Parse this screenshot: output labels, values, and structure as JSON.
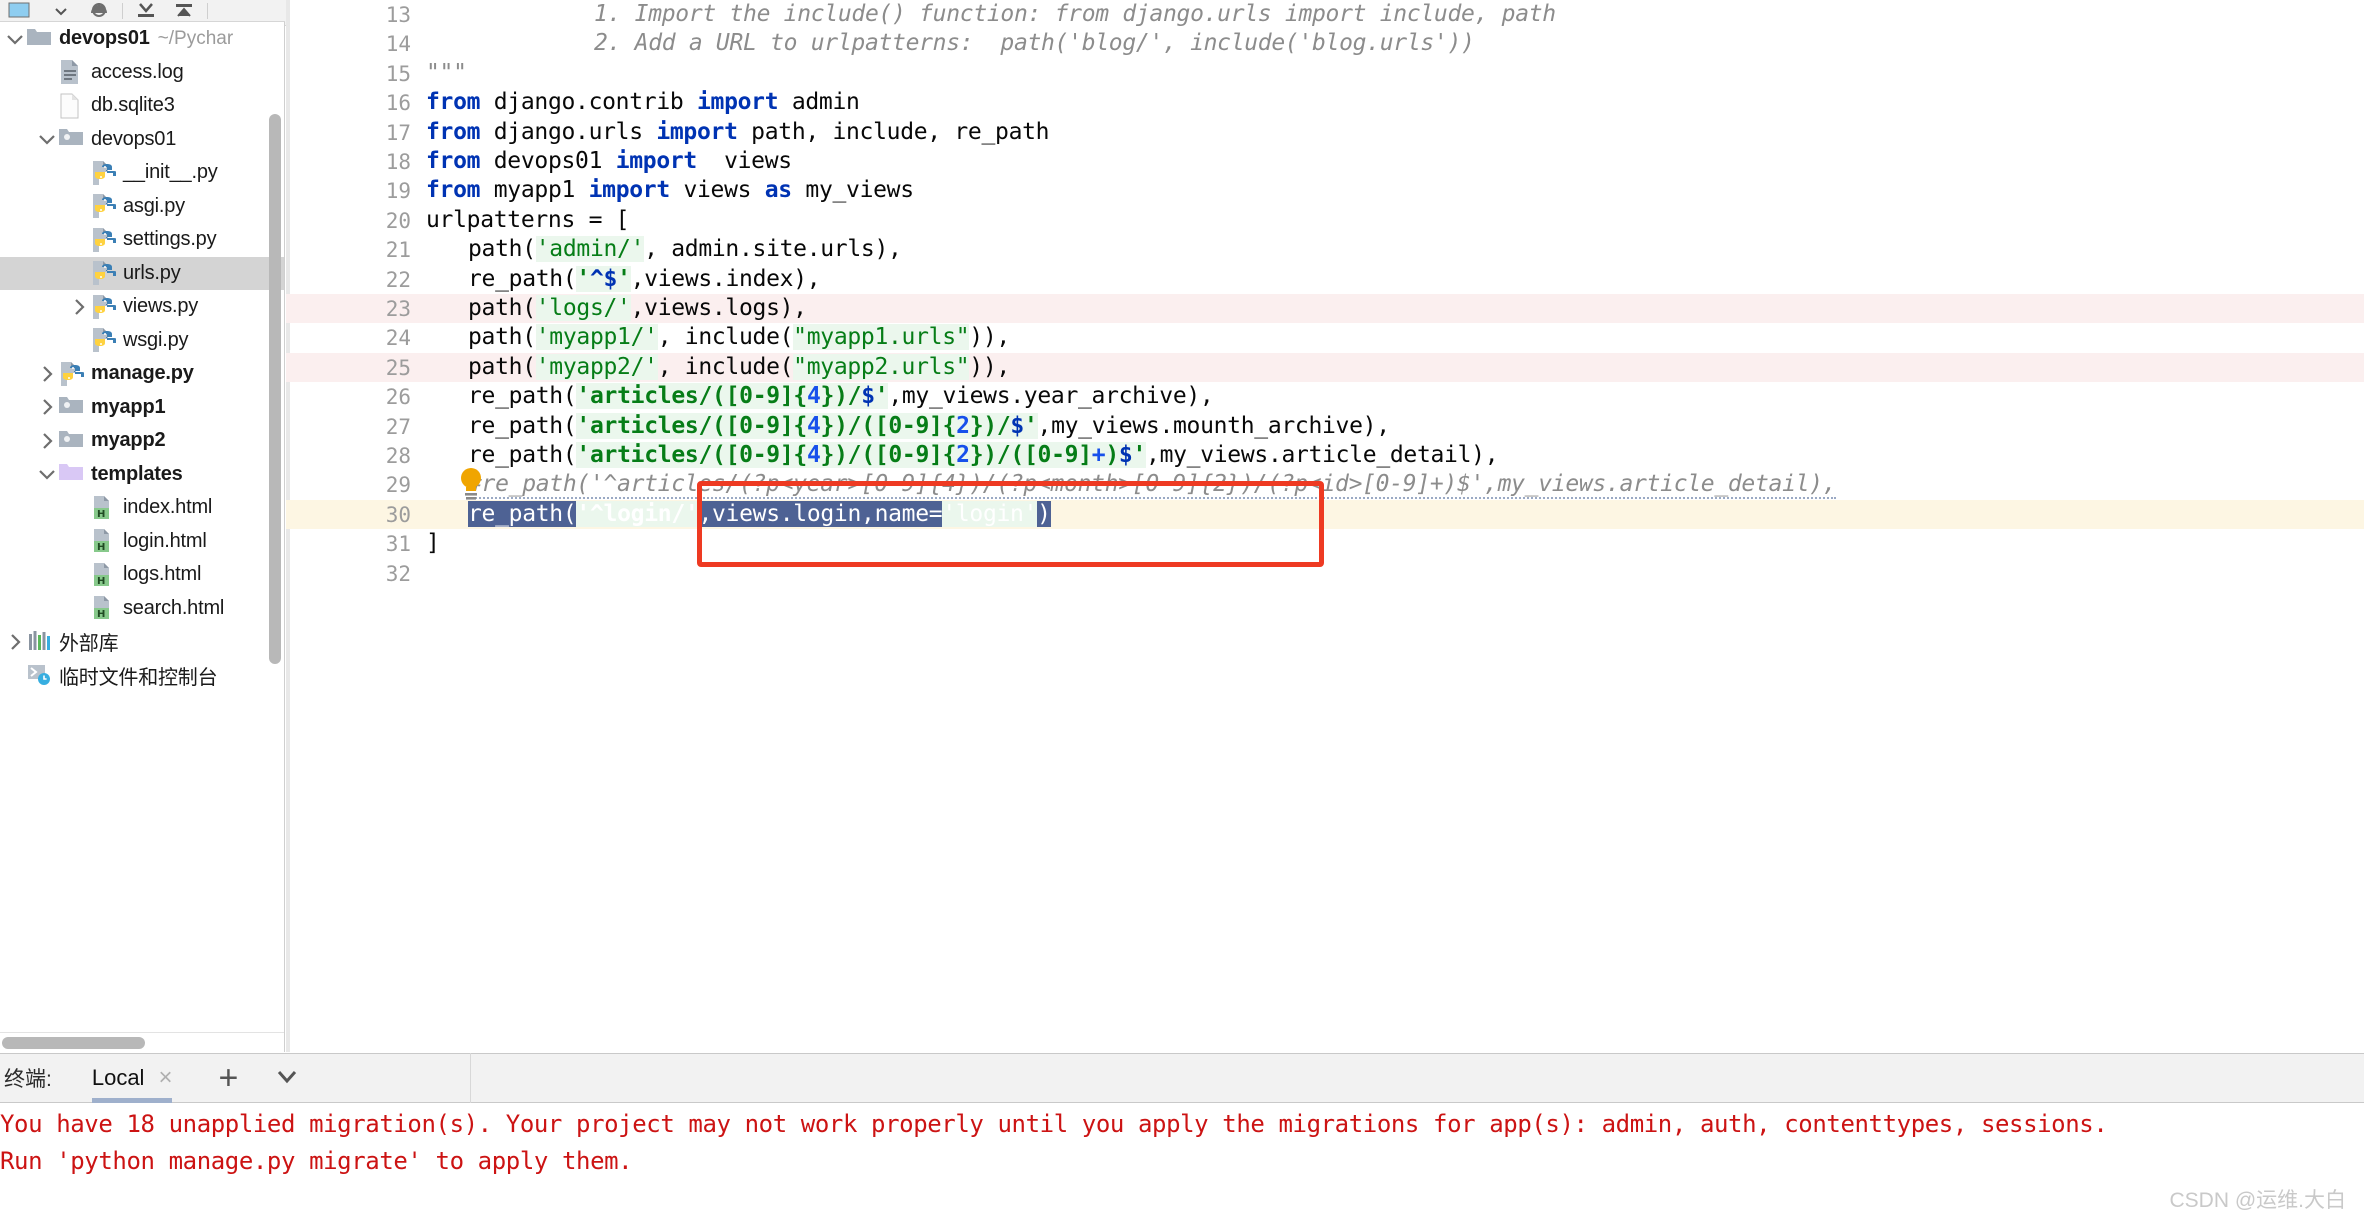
{
  "toolbar": {
    "icons": [
      "window-icon",
      "dropdown-caret",
      "bug-icon",
      "collapse-down-icon",
      "collapse-up-icon",
      "settings-gear-icon",
      "minimize-icon"
    ]
  },
  "sidebar": {
    "scrollbar": "vertical-scrollbar",
    "items": [
      {
        "label": "devops01",
        "hint": "~/Pychar",
        "icon": "folder-icon",
        "indent": 0,
        "twisty": "down",
        "bold": true,
        "selected": false
      },
      {
        "label": "access.log",
        "hint": "",
        "icon": "log-file-icon",
        "indent": 1,
        "twisty": "none",
        "bold": false,
        "selected": false
      },
      {
        "label": "db.sqlite3",
        "hint": "",
        "icon": "generic-file-icon",
        "indent": 1,
        "twisty": "none",
        "bold": false,
        "selected": false
      },
      {
        "label": "devops01",
        "hint": "",
        "icon": "folder-module-icon",
        "indent": 1,
        "twisty": "down",
        "bold": false,
        "selected": false
      },
      {
        "label": "__init__.py",
        "hint": "",
        "icon": "python-file-icon",
        "indent": 2,
        "twisty": "none",
        "bold": false,
        "selected": false
      },
      {
        "label": "asgi.py",
        "hint": "",
        "icon": "python-file-icon",
        "indent": 2,
        "twisty": "none",
        "bold": false,
        "selected": false
      },
      {
        "label": "settings.py",
        "hint": "",
        "icon": "python-file-icon",
        "indent": 2,
        "twisty": "none",
        "bold": false,
        "selected": false
      },
      {
        "label": "urls.py",
        "hint": "",
        "icon": "python-file-icon",
        "indent": 2,
        "twisty": "none",
        "bold": false,
        "selected": true
      },
      {
        "label": "views.py",
        "hint": "",
        "icon": "python-file-icon",
        "indent": 2,
        "twisty": "right",
        "bold": false,
        "selected": false
      },
      {
        "label": "wsgi.py",
        "hint": "",
        "icon": "python-file-icon",
        "indent": 2,
        "twisty": "none",
        "bold": false,
        "selected": false
      },
      {
        "label": "manage.py",
        "hint": "",
        "icon": "python-file-icon",
        "indent": 1,
        "twisty": "right",
        "bold": true,
        "selected": false
      },
      {
        "label": "myapp1",
        "hint": "",
        "icon": "folder-module-icon",
        "indent": 1,
        "twisty": "right",
        "bold": true,
        "selected": false
      },
      {
        "label": "myapp2",
        "hint": "",
        "icon": "folder-module-icon",
        "indent": 1,
        "twisty": "right",
        "bold": true,
        "selected": false
      },
      {
        "label": "templates",
        "hint": "",
        "icon": "folder-templates-icon",
        "indent": 1,
        "twisty": "down",
        "bold": true,
        "selected": false
      },
      {
        "label": "index.html",
        "hint": "",
        "icon": "html-file-icon",
        "indent": 2,
        "twisty": "none",
        "bold": false,
        "selected": false
      },
      {
        "label": "login.html",
        "hint": "",
        "icon": "html-file-icon",
        "indent": 2,
        "twisty": "none",
        "bold": false,
        "selected": false
      },
      {
        "label": "logs.html",
        "hint": "",
        "icon": "html-file-icon",
        "indent": 2,
        "twisty": "none",
        "bold": false,
        "selected": false
      },
      {
        "label": "search.html",
        "hint": "",
        "icon": "html-file-icon",
        "indent": 2,
        "twisty": "none",
        "bold": false,
        "selected": false
      },
      {
        "label": "外部库",
        "hint": "",
        "icon": "external-libraries-icon",
        "indent": 0,
        "twisty": "right",
        "bold": false,
        "selected": false
      },
      {
        "label": "临时文件和控制台",
        "hint": "",
        "icon": "scratches-consoles-icon",
        "indent": 0,
        "twisty": "none",
        "bold": false,
        "selected": false
      }
    ]
  },
  "editor": {
    "first_line_number": 13,
    "lines": [
      {
        "num": "13",
        "kind": "doc",
        "indent": 4,
        "text": "1. Import the include() function: from django.urls import include, path"
      },
      {
        "num": "14",
        "kind": "doc",
        "indent": 4,
        "text": "2. Add a URL to urlpatterns:  path('blog/', include('blog.urls'))"
      },
      {
        "num": "15",
        "kind": "doc",
        "indent": 0,
        "text": "\"\"\""
      },
      {
        "num": "16",
        "kind": "code",
        "indent": 0,
        "text": "from django.contrib import admin"
      },
      {
        "num": "17",
        "kind": "code",
        "indent": 0,
        "text": "from django.urls import path, include, re_path"
      },
      {
        "num": "18",
        "kind": "code",
        "indent": 0,
        "text": "from devops01 import  views"
      },
      {
        "num": "19",
        "kind": "code",
        "indent": 0,
        "text": "from myapp1 import views as my_views"
      },
      {
        "num": "20",
        "kind": "code",
        "indent": 0,
        "text": "urlpatterns = ["
      },
      {
        "num": "21",
        "kind": "code",
        "indent": 1,
        "text": "path('admin/', admin.site.urls),"
      },
      {
        "num": "22",
        "kind": "code",
        "indent": 1,
        "text": "re_path('^$',views.index),"
      },
      {
        "num": "23",
        "kind": "code",
        "indent": 1,
        "text": "path('logs/',views.logs),",
        "row": "pink"
      },
      {
        "num": "24",
        "kind": "code",
        "indent": 1,
        "text": "path('myapp1/', include(\"myapp1.urls\")),"
      },
      {
        "num": "25",
        "kind": "code",
        "indent": 1,
        "text": "path('myapp2/', include(\"myapp2.urls\")),",
        "row": "pink"
      },
      {
        "num": "26",
        "kind": "code",
        "indent": 1,
        "text": "re_path('articles/([0-9]{4})/$',my_views.year_archive),"
      },
      {
        "num": "27",
        "kind": "code",
        "indent": 1,
        "text": "re_path('articles/([0-9]{4})/([0-9]{2})/$',my_views.mounth_archive),"
      },
      {
        "num": "28",
        "kind": "code",
        "indent": 1,
        "text": "re_path('articles/([0-9]{4})/([0-9]{2})/([0-9]+)$',my_views.article_detail),"
      },
      {
        "num": "29",
        "kind": "comment",
        "indent": 1,
        "text": "#re_path('^articles/(?p<year>[0-9]{4})/(?p<month>[0-9]{2})/(?p<id>[0-9]+)$',my_views.article_detail),"
      },
      {
        "num": "30",
        "kind": "selected",
        "indent": 1,
        "text": "re_path('^login/',views.login,name='login')",
        "row": "yellow"
      },
      {
        "num": "31",
        "kind": "code",
        "indent": 0,
        "text": "]"
      },
      {
        "num": "32",
        "kind": "code",
        "indent": 0,
        "text": ""
      }
    ],
    "bulb_icon": "intention-bulb-icon",
    "annotation_box": "red-highlight-box"
  },
  "terminal": {
    "title": "终端:",
    "tab_label": "Local",
    "close_label": "×",
    "add_label": "+",
    "chevron": "chevron-down-icon",
    "output_line_1": "You have 18 unapplied migration(s). Your project may not work properly until you apply the migrations for app(s): admin, auth, contenttypes, sessions.",
    "output_line_2": "Run 'python manage.py migrate' to apply them."
  },
  "watermark": "CSDN @运维.大白",
  "colors": {
    "keyword": "#0033b3",
    "string": "#067d17",
    "comment": "#8c8c8c",
    "selection": "#4e6294",
    "error_text": "#cc1313",
    "annotation": "#ee3a22",
    "pink_row": "#fbefef",
    "yellow_row": "#fdf6e3"
  }
}
